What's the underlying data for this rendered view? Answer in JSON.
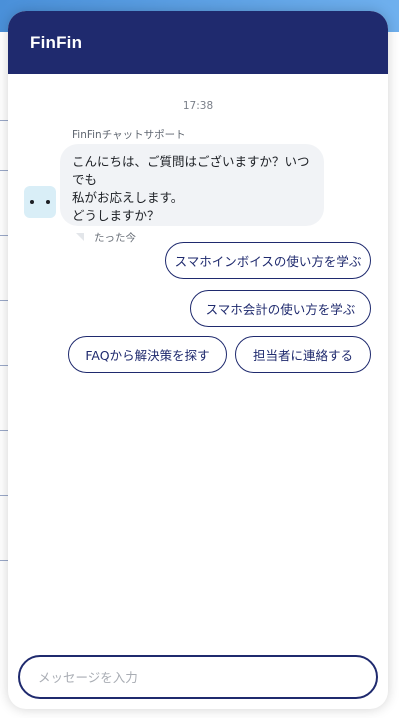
{
  "chat": {
    "title": "FinFin",
    "timestamp": "17:38",
    "sender": "FinFinチャットサポート",
    "message": "こんにちは、ご質問はございますか？いつでも\n私がお応えします。\nどうしますか？",
    "time_ago": "たった今",
    "quick_replies": [
      "スマホインボイスの使い方を学ぶ",
      "スマホ会計の使い方を学ぶ",
      "FAQから解決策を探す",
      "担当者に連絡する"
    ],
    "input_placeholder": "メッセージを入力"
  },
  "colors": {
    "header": "#1f2a6e",
    "accent": "#1f2a6e",
    "bubble": "#f1f3f6",
    "avatar": "#d9eef7"
  }
}
